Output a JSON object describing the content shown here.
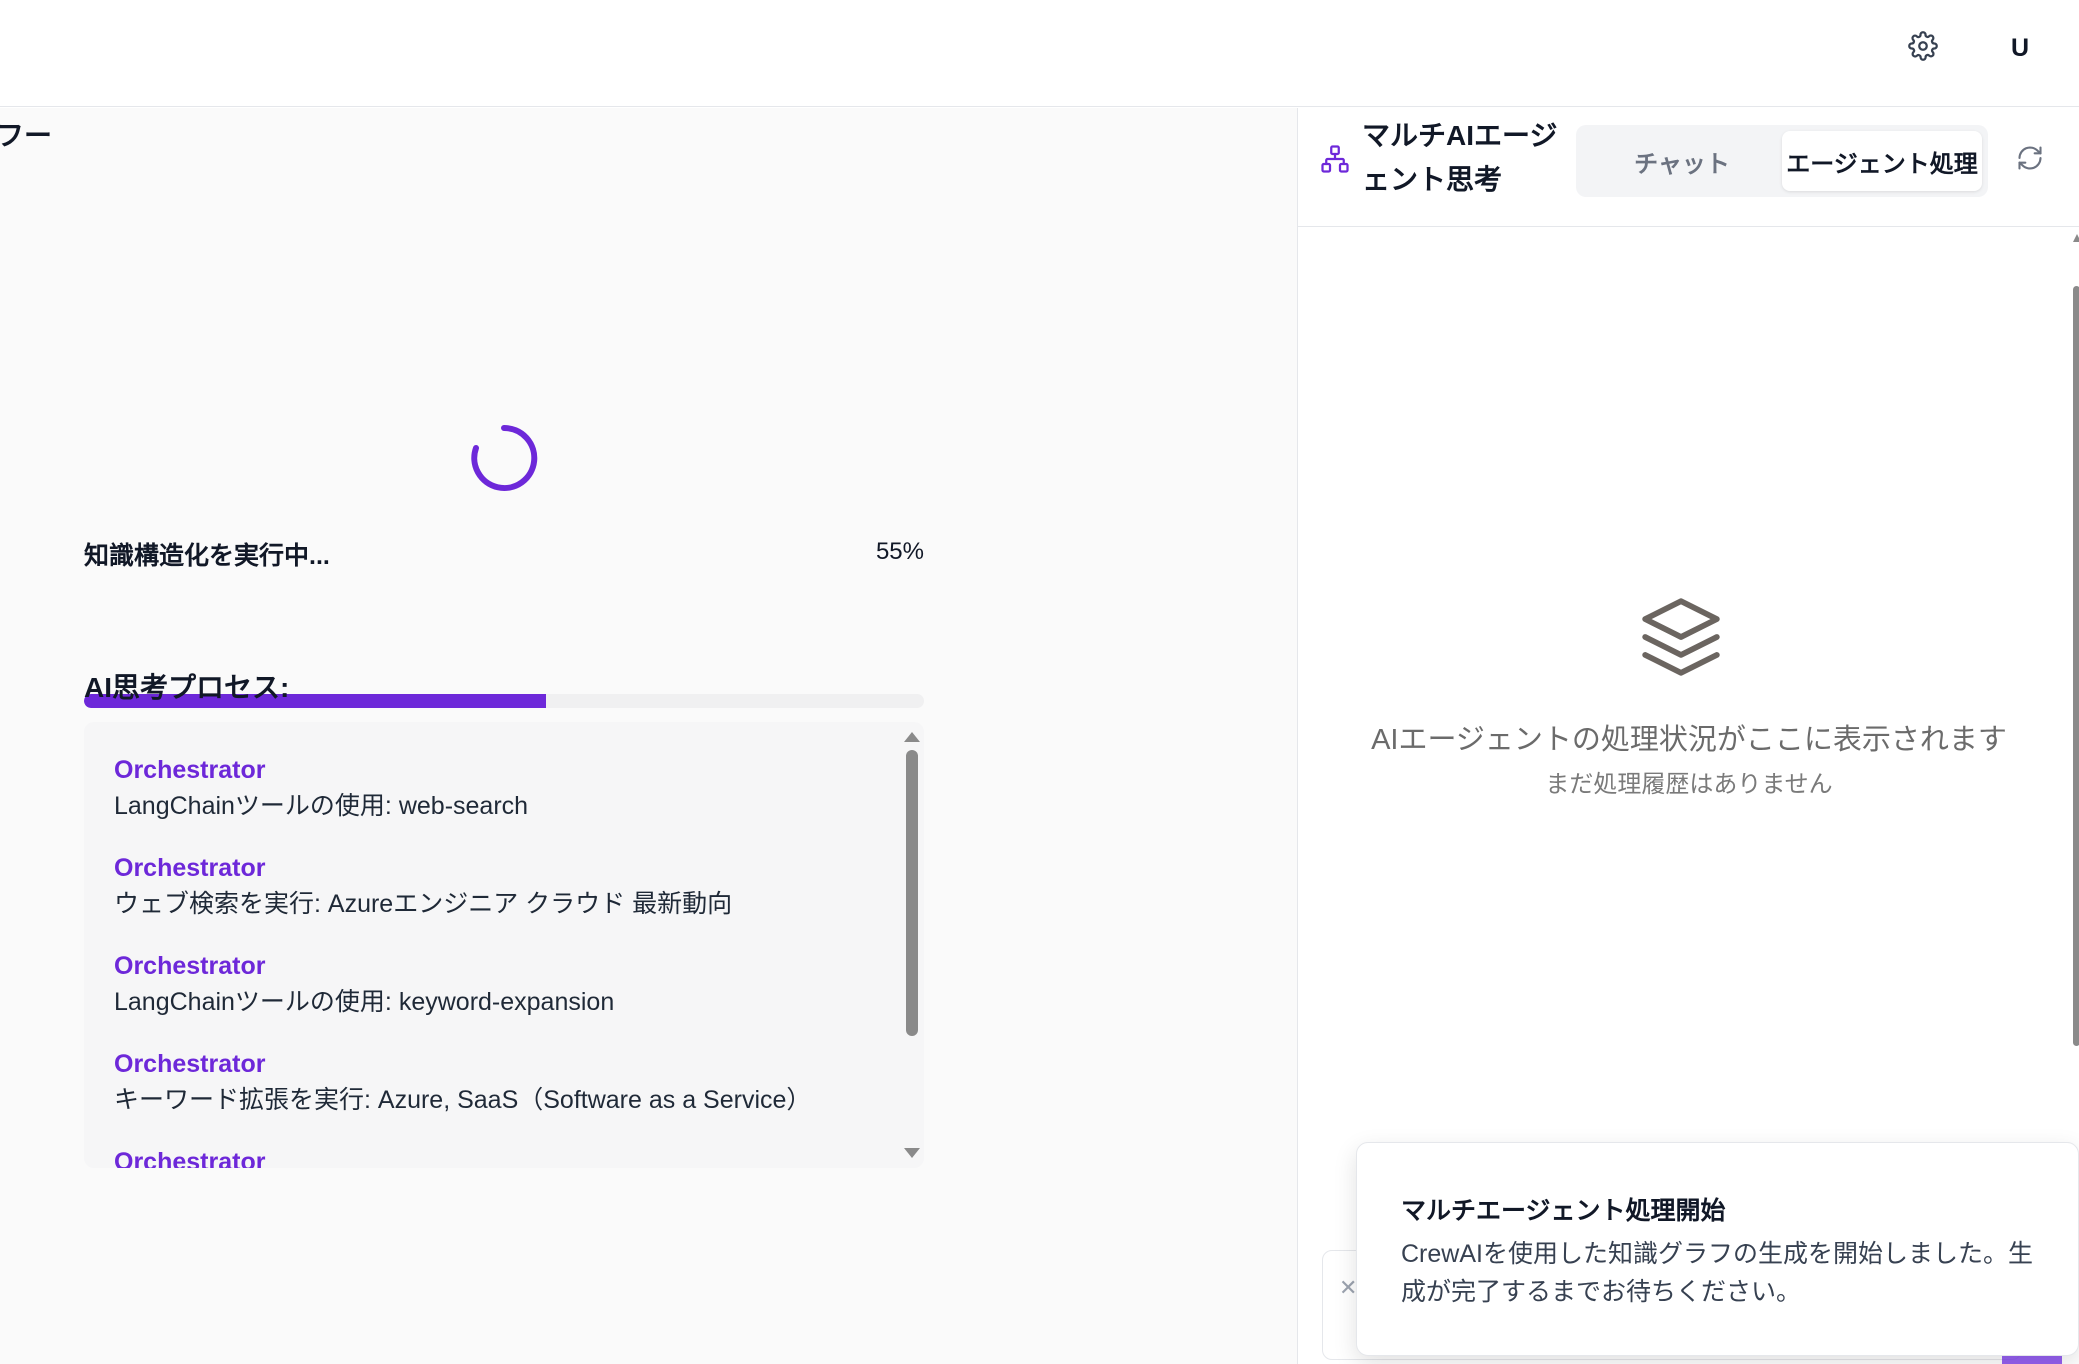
{
  "header": {
    "settings_icon": "gear-icon",
    "avatar_initial": "U"
  },
  "main": {
    "title_fragment": "フー",
    "progress": {
      "label": "知識構造化を実行中...",
      "value_text": "55%",
      "percent": 55
    },
    "process_heading": "AI思考プロセス:",
    "log_items": [
      {
        "agent": "Orchestrator",
        "text": "LangChainツールの使用: web-search"
      },
      {
        "agent": "Orchestrator",
        "text": "ウェブ検索を実行: Azureエンジニア クラウド 最新動向"
      },
      {
        "agent": "Orchestrator",
        "text": "LangChainツールの使用: keyword-expansion"
      },
      {
        "agent": "Orchestrator",
        "text": "キーワード拡張を実行: Azure, SaaS（Software as a Service）"
      },
      {
        "agent": "Orchestrator",
        "text": ""
      }
    ]
  },
  "right_panel": {
    "title": "マルチAIエージェント思考",
    "tabs": {
      "chat": "チャット",
      "agent": "エージェント処理"
    },
    "active_tab": "agent",
    "empty_state": {
      "title": "AIエージェントの処理状況がここに表示されます",
      "subtitle": "まだ処理履歴はありません",
      "icon": "layers-icon"
    }
  },
  "toast": {
    "title": "マルチエージェント処理開始",
    "body": "CrewAIを使用した知識グラフの生成を開始しました。生成が完了するまでお待ちください。"
  },
  "colors": {
    "accent": "#6d28d9",
    "muted_text": "#6b7280"
  }
}
